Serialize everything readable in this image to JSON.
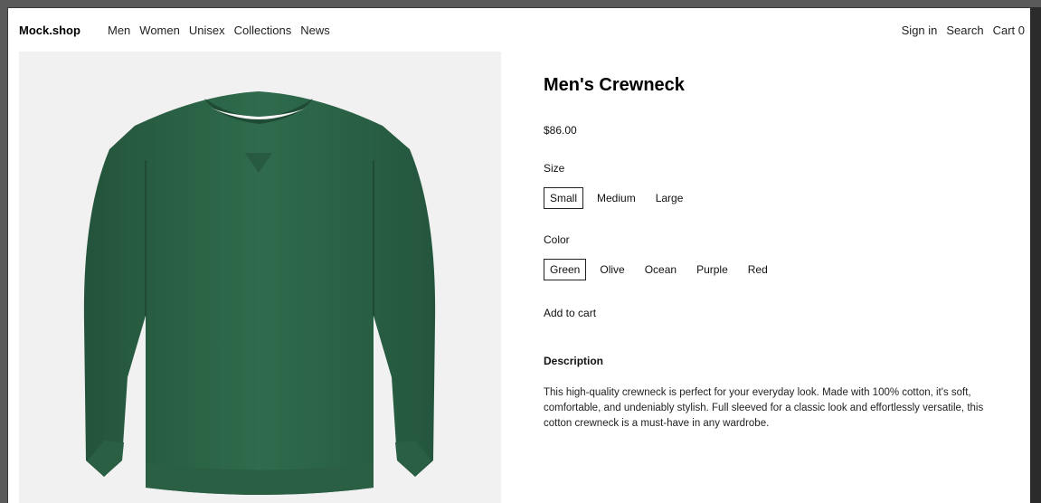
{
  "header": {
    "logo": "Mock.shop",
    "nav": [
      "Men",
      "Women",
      "Unisex",
      "Collections",
      "News"
    ],
    "actions": {
      "sign_in": "Sign in",
      "search": "Search",
      "cart": "Cart 0"
    }
  },
  "product": {
    "title": "Men's Crewneck",
    "price": "$86.00",
    "image_colors": {
      "background": "#f1f1f1",
      "sweater": "#2f6b4c"
    },
    "size_label": "Size",
    "sizes": [
      "Small",
      "Medium",
      "Large"
    ],
    "selected_size": "Small",
    "color_label": "Color",
    "colors": [
      "Green",
      "Olive",
      "Ocean",
      "Purple",
      "Red"
    ],
    "selected_color": "Green",
    "add_to_cart": "Add to cart",
    "description_heading": "Description",
    "description": "This high-quality crewneck is perfect for your everyday look. Made with 100% cotton, it's soft, comfortable, and undeniably stylish. Full sleeved for a classic look and effortlessly versatile, this cotton crewneck is a must-have in any wardrobe."
  }
}
